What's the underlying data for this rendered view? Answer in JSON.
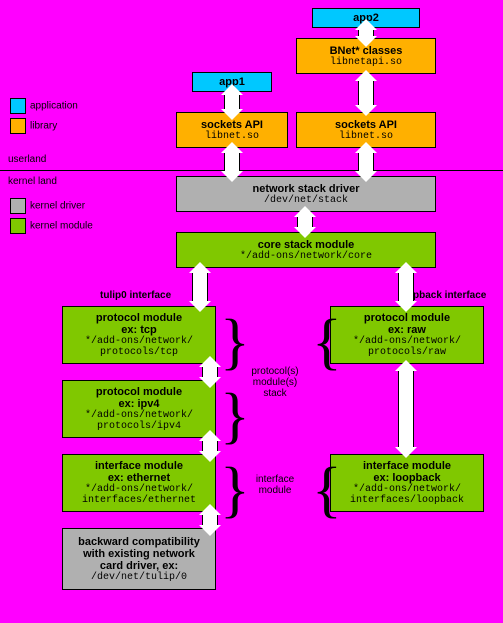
{
  "legend": {
    "userland": {
      "application": {
        "color": "#00c8ff",
        "label": "application"
      },
      "library": {
        "color": "#ffb000",
        "label": "library"
      },
      "section": "userland"
    },
    "kernelland": {
      "driver": {
        "color": "#b0b0b0",
        "label": "kernel driver"
      },
      "module": {
        "color": "#80c800",
        "label": "kernel module"
      },
      "section": "kernel land"
    }
  },
  "apps": {
    "app1": "app1",
    "app2": "app2"
  },
  "bnet": {
    "title": "BNet* classes",
    "lib": "libnetapi.so"
  },
  "sockets1": {
    "title": "sockets API",
    "lib": "libnet.so"
  },
  "sockets2": {
    "title": "sockets API",
    "lib": "libnet.so"
  },
  "nsd": {
    "title": "network stack driver",
    "path": "/dev/net/stack"
  },
  "core": {
    "title": "core stack module",
    "path": "*/add-ons/network/core"
  },
  "ifaces": {
    "tulip": "tulip0 interface",
    "loopback": "loopback interface"
  },
  "ptcp": {
    "title": "protocol module",
    "ex": "ex: tcp",
    "path1": "*/add-ons/network/",
    "path2": "protocols/tcp"
  },
  "pipv4": {
    "title": "protocol module",
    "ex": "ex: ipv4",
    "path1": "*/add-ons/network/",
    "path2": "protocols/ipv4"
  },
  "ieth": {
    "title": "interface module",
    "ex": "ex: ethernet",
    "path1": "*/add-ons/network/",
    "path2": "interfaces/ethernet"
  },
  "praw": {
    "title": "protocol module",
    "ex": "ex: raw",
    "path1": "*/add-ons/network/",
    "path2": "protocols/raw"
  },
  "iloop": {
    "title": "interface module",
    "ex": "ex: loopback",
    "path1": "*/add-ons/network/",
    "path2": "interfaces/loopback"
  },
  "compat": {
    "l1": "backward compatibility",
    "l2": "with existing network",
    "l3": "card driver, ex:",
    "path": "/dev/net/tulip/0"
  },
  "annot": {
    "protostack": "protocol(s) module(s) stack",
    "ifacemod": "interface module"
  }
}
